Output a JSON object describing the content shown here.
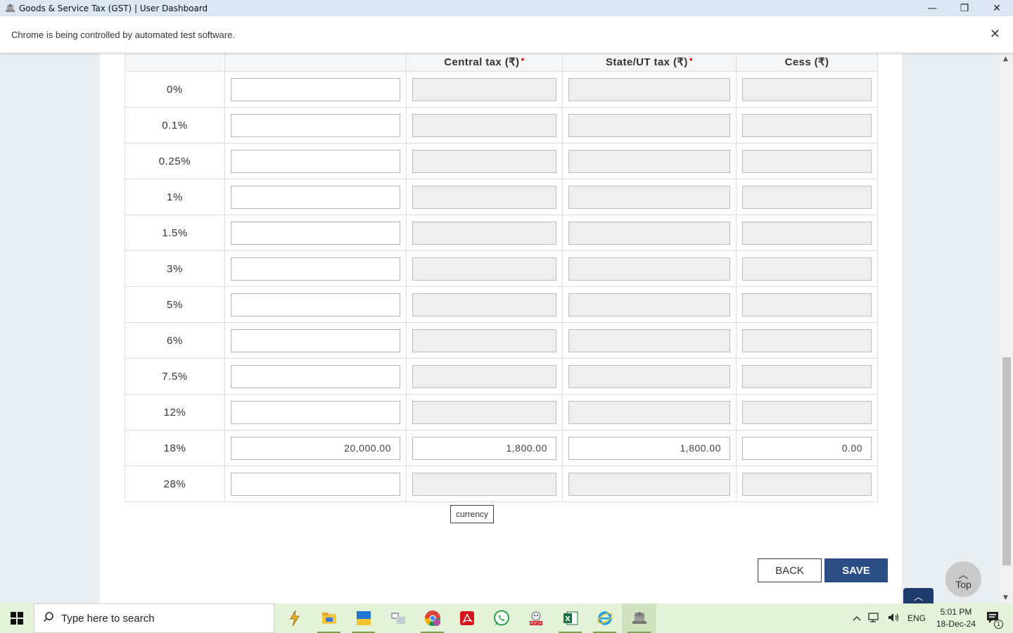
{
  "window": {
    "title": "Goods & Service Tax (GST) | User Dashboard",
    "minimize": "—",
    "restore": "❐",
    "close": "✕"
  },
  "infobar": {
    "message": "Chrome is being controlled by automated test software.",
    "close": "✕"
  },
  "table": {
    "headers": {
      "rate": "",
      "taxable": "",
      "central": "Central tax (₹)",
      "state": "State/UT tax (₹)",
      "cess": "Cess (₹)"
    },
    "required_marker": "•",
    "rows": [
      {
        "rate": "0%",
        "taxable": "",
        "central": "",
        "state": "",
        "cess": ""
      },
      {
        "rate": "0.1%",
        "taxable": "",
        "central": "",
        "state": "",
        "cess": ""
      },
      {
        "rate": "0.25%",
        "taxable": "",
        "central": "",
        "state": "",
        "cess": ""
      },
      {
        "rate": "1%",
        "taxable": "",
        "central": "",
        "state": "",
        "cess": ""
      },
      {
        "rate": "1.5%",
        "taxable": "",
        "central": "",
        "state": "",
        "cess": ""
      },
      {
        "rate": "3%",
        "taxable": "",
        "central": "",
        "state": "",
        "cess": ""
      },
      {
        "rate": "5%",
        "taxable": "",
        "central": "",
        "state": "",
        "cess": ""
      },
      {
        "rate": "6%",
        "taxable": "",
        "central": "",
        "state": "",
        "cess": ""
      },
      {
        "rate": "7.5%",
        "taxable": "",
        "central": "",
        "state": "",
        "cess": ""
      },
      {
        "rate": "12%",
        "taxable": "",
        "central": "",
        "state": "",
        "cess": ""
      },
      {
        "rate": "18%",
        "taxable": "20,000.00",
        "central": "1,800.00",
        "state": "1,800.00",
        "cess": "0.00"
      },
      {
        "rate": "28%",
        "taxable": "",
        "central": "",
        "state": "",
        "cess": ""
      }
    ]
  },
  "tooltip": "currency",
  "buttons": {
    "back": "BACK",
    "save": "SAVE",
    "top": "Top",
    "top_chevron": "︿",
    "chat_chevron": "︿"
  },
  "taskbar": {
    "search_placeholder": "Type here to search",
    "language": "ENG",
    "time": "5:01 PM",
    "date": "18-Dec-24",
    "notification_count": "1"
  },
  "colors": {
    "save_button": "#2c4e86",
    "required": "#e02020",
    "taskbar": "#e4f3d7",
    "titlebar": "#dce6f4"
  }
}
